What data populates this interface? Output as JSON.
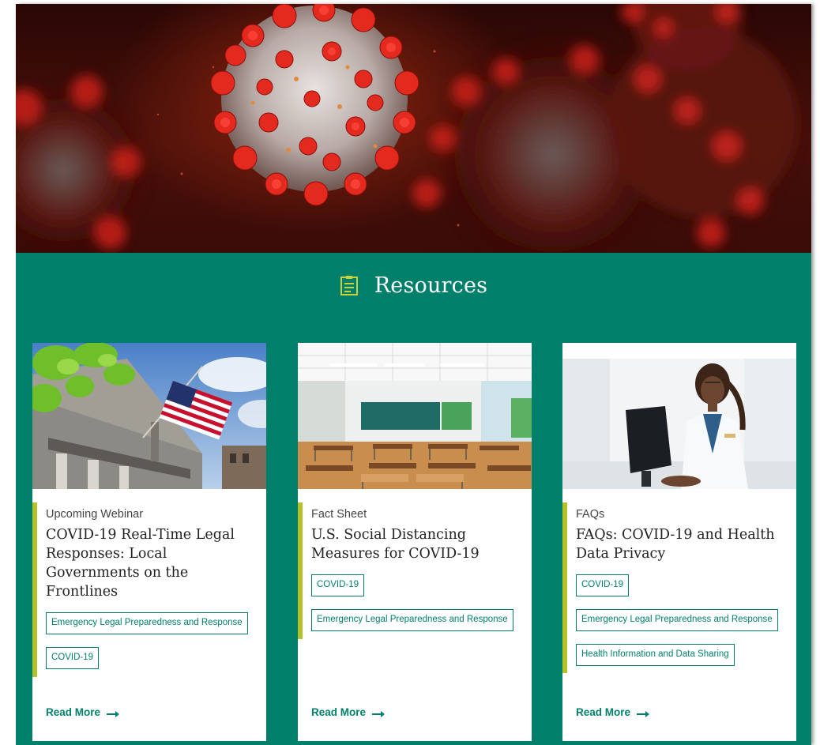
{
  "colors": {
    "teal": "#00806b",
    "accent_lime": "#b6c02b",
    "tag_border": "#00806b"
  },
  "hero": {
    "image": "coronavirus-particles-illustration"
  },
  "section": {
    "icon": "document-list-icon",
    "title": "Resources"
  },
  "cards": [
    {
      "image": "city-hall-with-american-flag",
      "category": "Upcoming Webinar",
      "title": "COVID-19 Real-Time Legal Responses: Local Governments on the Frontlines",
      "tags": [
        "Emergency Legal Preparedness and Response",
        "COVID-19"
      ],
      "read_more": "Read More"
    },
    {
      "image": "empty-classroom",
      "category": "Fact Sheet",
      "title": "U.S. Social Distancing Measures for COVID-19",
      "tags": [
        "COVID-19",
        "Emergency Legal Preparedness and Response"
      ],
      "read_more": "Read More"
    },
    {
      "image": "scientist-at-computer",
      "category": "FAQs",
      "title": "FAQs: COVID-19 and Health Data Privacy",
      "tags": [
        "COVID-19",
        "Emergency Legal Preparedness and Response",
        "Health Information and Data Sharing"
      ],
      "read_more": "Read More"
    }
  ]
}
